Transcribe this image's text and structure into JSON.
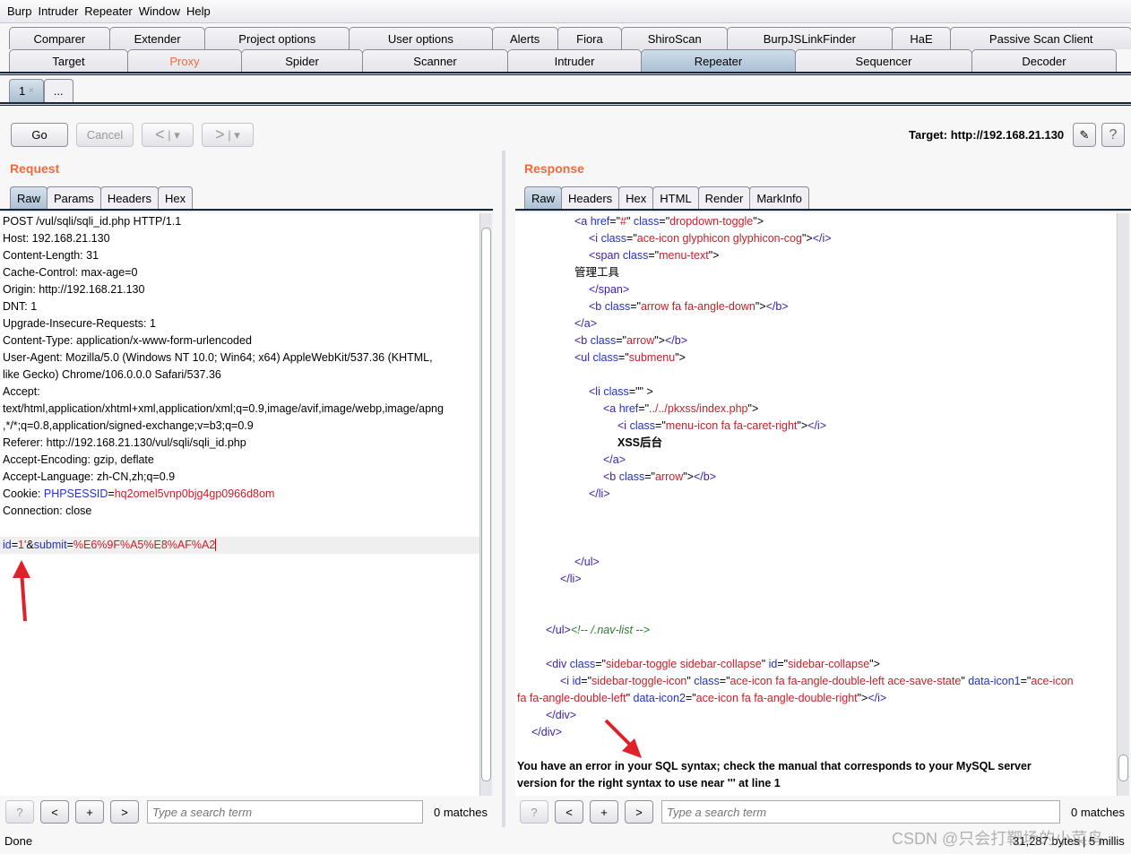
{
  "menu": [
    "Burp",
    "Intruder",
    "Repeater",
    "Window",
    "Help"
  ],
  "tabs_row1": [
    "Comparer",
    "Extender",
    "Project options",
    "User options",
    "Alerts",
    "Fiora",
    "ShiroScan",
    "BurpJSLinkFinder",
    "HaE",
    "Passive Scan Client"
  ],
  "tabs_row2": [
    "Target",
    "Proxy",
    "Spider",
    "Scanner",
    "Intruder",
    "Repeater",
    "Sequencer",
    "Decoder"
  ],
  "selected_tab": "Repeater",
  "repeater_tabs": {
    "tab1": "1",
    "tab1_close": "×",
    "new": "..."
  },
  "toolbar": {
    "go": "Go",
    "cancel": "Cancel",
    "back": "<",
    "fwd": ">",
    "dropdown": "▾",
    "target": "Target: http://192.168.21.130",
    "edit_icon": "pencil-icon",
    "help": "?"
  },
  "request": {
    "title": "Request",
    "tabs": [
      "Raw",
      "Params",
      "Headers",
      "Hex"
    ],
    "lines": [
      [
        [
          "t",
          "POST /vul/sqli/sqli_id.php HTTP/1.1"
        ]
      ],
      [
        [
          "t",
          "Host: 192.168.21.130"
        ]
      ],
      [
        [
          "t",
          "Content-Length: 31"
        ]
      ],
      [
        [
          "t",
          "Cache-Control: max-age=0"
        ]
      ],
      [
        [
          "t",
          "Origin: http://192.168.21.130"
        ]
      ],
      [
        [
          "t",
          "DNT: 1"
        ]
      ],
      [
        [
          "t",
          "Upgrade-Insecure-Requests: 1"
        ]
      ],
      [
        [
          "t",
          "Content-Type: application/x-www-form-urlencoded"
        ]
      ],
      [
        [
          "t",
          "User-Agent: Mozilla/5.0 (Windows NT 10.0; Win64; x64) AppleWebKit/537.36 (KHTML,"
        ]
      ],
      [
        [
          "t",
          "like Gecko) Chrome/106.0.0.0 Safari/537.36"
        ]
      ],
      [
        [
          "t",
          "Accept:"
        ]
      ],
      [
        [
          "t",
          "text/html,application/xhtml+xml,application/xml;q=0.9,image/avif,image/webp,image/apng"
        ]
      ],
      [
        [
          "t",
          ",*/*;q=0.8,application/signed-exchange;v=b3;q=0.9"
        ]
      ],
      [
        [
          "t",
          "Referer: http://192.168.21.130/vul/sqli/sqli_id.php"
        ]
      ],
      [
        [
          "t",
          "Accept-Encoding: gzip, deflate"
        ]
      ],
      [
        [
          "t",
          "Accept-Language: zh-CN,zh;q=0.9"
        ]
      ],
      [
        [
          "t",
          "Cookie: "
        ],
        [
          "key",
          "PHPSESSID"
        ],
        [
          "t",
          "="
        ],
        [
          "val",
          "hq2omel5vnp0bjg4gp0966d8om"
        ]
      ],
      [
        [
          "t",
          "Connection: close"
        ]
      ],
      [],
      [
        [
          "key",
          "id"
        ],
        [
          "t",
          "="
        ],
        [
          "val",
          "1'"
        ],
        [
          "t",
          "&"
        ],
        [
          "key",
          "submit"
        ],
        [
          "t",
          "="
        ],
        [
          "val",
          "%E6%9F%A5%E8%AF%A2"
        ]
      ]
    ],
    "search_placeholder": "Type a search term",
    "matches": "0 matches"
  },
  "response": {
    "title": "Response",
    "tabs": [
      "Raw",
      "Headers",
      "Hex",
      "HTML",
      "Render",
      "MarkInfo"
    ],
    "lines": [
      [
        64,
        [
          [
            "tag",
            "<a "
          ],
          [
            "attr",
            "href"
          ],
          [
            "t",
            "=\""
          ],
          [
            "val",
            "#"
          ],
          [
            "t",
            "\" "
          ],
          [
            "attr",
            "class"
          ],
          [
            "t",
            "=\""
          ],
          [
            "val",
            "dropdown-toggle"
          ],
          [
            "t",
            "\">"
          ]
        ]
      ],
      [
        80,
        [
          [
            "tag",
            "<i "
          ],
          [
            "attr",
            "class"
          ],
          [
            "t",
            "=\""
          ],
          [
            "val",
            "ace-icon glyphicon glyphicon-cog"
          ],
          [
            "t",
            "\">"
          ],
          [
            "tag",
            "</i>"
          ]
        ]
      ],
      [
        80,
        [
          [
            "tag",
            "<span "
          ],
          [
            "attr",
            "class"
          ],
          [
            "t",
            "=\""
          ],
          [
            "val",
            "menu-text"
          ],
          [
            "t",
            "\">"
          ]
        ]
      ],
      [
        64,
        [
          [
            "t",
            "管理工具"
          ]
        ]
      ],
      [
        80,
        [
          [
            "tag",
            "</span>"
          ]
        ]
      ],
      [
        80,
        [
          [
            "tag",
            "<b "
          ],
          [
            "attr",
            "class"
          ],
          [
            "t",
            "=\""
          ],
          [
            "val",
            "arrow fa fa-angle-down"
          ],
          [
            "t",
            "\">"
          ],
          [
            "tag",
            "</b>"
          ]
        ]
      ],
      [
        64,
        [
          [
            "tag",
            "</a>"
          ]
        ]
      ],
      [
        64,
        [
          [
            "tag",
            "<b "
          ],
          [
            "attr",
            "class"
          ],
          [
            "t",
            "=\""
          ],
          [
            "val",
            "arrow"
          ],
          [
            "t",
            "\">"
          ],
          [
            "tag",
            "</b>"
          ]
        ]
      ],
      [
        64,
        [
          [
            "tag",
            "<ul "
          ],
          [
            "attr",
            "class"
          ],
          [
            "t",
            "=\""
          ],
          [
            "val",
            "submenu"
          ],
          [
            "t",
            "\">"
          ]
        ]
      ],
      [
        0,
        []
      ],
      [
        80,
        [
          [
            "tag",
            "<li "
          ],
          [
            "attr",
            "class"
          ],
          [
            "t",
            "=\"\" >"
          ]
        ]
      ],
      [
        96,
        [
          [
            "tag",
            "<a "
          ],
          [
            "attr",
            "href"
          ],
          [
            "t",
            "=\""
          ],
          [
            "val",
            "../../pkxss/index.php"
          ],
          [
            "t",
            "\">"
          ]
        ]
      ],
      [
        112,
        [
          [
            "tag",
            "<i "
          ],
          [
            "attr",
            "class"
          ],
          [
            "t",
            "=\""
          ],
          [
            "val",
            "menu-icon fa fa-caret-right"
          ],
          [
            "t",
            "\">"
          ],
          [
            "tag",
            "</i>"
          ]
        ]
      ],
      [
        112,
        [
          [
            "b",
            "XSS后台"
          ]
        ]
      ],
      [
        96,
        [
          [
            "tag",
            "</a>"
          ]
        ]
      ],
      [
        96,
        [
          [
            "tag",
            "<b "
          ],
          [
            "attr",
            "class"
          ],
          [
            "t",
            "=\""
          ],
          [
            "val",
            "arrow"
          ],
          [
            "t",
            "\">"
          ],
          [
            "tag",
            "</b>"
          ]
        ]
      ],
      [
        80,
        [
          [
            "tag",
            "</li>"
          ]
        ]
      ],
      [
        0,
        []
      ],
      [
        0,
        []
      ],
      [
        0,
        []
      ],
      [
        64,
        [
          [
            "tag",
            "</ul>"
          ]
        ]
      ],
      [
        48,
        [
          [
            "tag",
            "</li>"
          ]
        ]
      ],
      [
        0,
        []
      ],
      [
        0,
        []
      ],
      [
        32,
        [
          [
            "tag",
            "</ul>"
          ],
          [
            "cm",
            "<!-- /.nav-list -->"
          ]
        ]
      ],
      [
        0,
        []
      ],
      [
        32,
        [
          [
            "tag",
            "<div "
          ],
          [
            "attr",
            "class"
          ],
          [
            "t",
            "=\""
          ],
          [
            "val",
            "sidebar-toggle sidebar-collapse"
          ],
          [
            "t",
            "\" "
          ],
          [
            "attr",
            "id"
          ],
          [
            "t",
            "=\""
          ],
          [
            "val",
            "sidebar-collapse"
          ],
          [
            "t",
            "\">"
          ]
        ]
      ],
      [
        48,
        [
          [
            "tag",
            "<i "
          ],
          [
            "attr",
            "id"
          ],
          [
            "t",
            "=\""
          ],
          [
            "val",
            "sidebar-toggle-icon"
          ],
          [
            "t",
            "\" "
          ],
          [
            "attr",
            "class"
          ],
          [
            "t",
            "=\""
          ],
          [
            "val",
            "ace-icon fa fa-angle-double-left ace-save-state"
          ],
          [
            "t",
            "\" "
          ],
          [
            "attr",
            "data-icon1"
          ],
          [
            "t",
            "=\""
          ],
          [
            "val",
            "ace-icon"
          ]
        ]
      ],
      [
        0,
        [
          [
            "val",
            "fa fa-angle-double-left"
          ],
          [
            "t",
            "\" "
          ],
          [
            "attr",
            "data-icon2"
          ],
          [
            "t",
            "=\""
          ],
          [
            "val",
            "ace-icon fa fa-angle-double-right"
          ],
          [
            "t",
            "\">"
          ],
          [
            "tag",
            "</i>"
          ]
        ]
      ],
      [
        32,
        [
          [
            "tag",
            "</div>"
          ]
        ]
      ],
      [
        16,
        [
          [
            "tag",
            "</div>"
          ]
        ]
      ],
      [
        0,
        []
      ],
      [
        0,
        [
          [
            "b",
            "You have an error in your SQL syntax; check the manual that corresponds to your MySQL server"
          ]
        ]
      ],
      [
        0,
        [
          [
            "b",
            "version for the right syntax to use near ''' at line 1"
          ]
        ]
      ]
    ],
    "search_placeholder": "Type a search term",
    "matches": "0 matches"
  },
  "search_buttons": [
    "?",
    "<",
    "+",
    ">"
  ],
  "status": {
    "left": "Done",
    "right": "31,287 bytes | 5 millis"
  },
  "watermark": "CSDN @只会打靶场的小菜鸟",
  "colors": {
    "accent": "#f26a3a",
    "selected_tab": "#aac0d3",
    "annotation_arrow": "#e0202a"
  }
}
